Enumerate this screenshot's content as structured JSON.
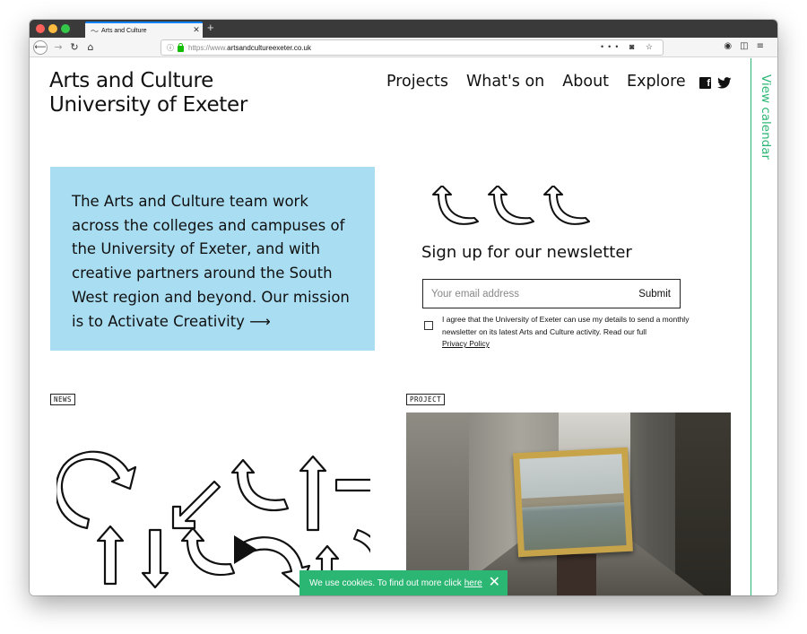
{
  "browser": {
    "tab_title": "Arts and Culture",
    "new_tab_symbol": "+",
    "url_protocol": "https://www.",
    "url_host": "artsandcultureexeter.co.uk"
  },
  "header": {
    "logo_line1": "Arts and Culture",
    "logo_line2": "University of Exeter",
    "nav": [
      "Projects",
      "What's on",
      "About",
      "Explore"
    ],
    "calendar_label": "View calendar"
  },
  "intro": {
    "text": "The Arts and Culture team work across the colleges and campuses of the University of Exeter, and with creative partners around the South West region and beyond. Our mission is to Activate Creativity ⟶"
  },
  "newsletter": {
    "title": "Sign up for our newsletter",
    "email_placeholder": "Your email address",
    "submit_label": "Submit",
    "consent_text": "I agree that the University of Exeter can use my details to send a monthly newsletter on its latest Arts and Culture activity. Read our full",
    "privacy_link": "Privacy Policy"
  },
  "cards": {
    "news_tag": "NEWS",
    "project_tag": "PROJECT"
  },
  "cookie": {
    "text": "We use cookies. To find out more click",
    "link": "here"
  },
  "colors": {
    "accent_green": "#2bb673",
    "intro_blue": "#a9ddf2"
  }
}
